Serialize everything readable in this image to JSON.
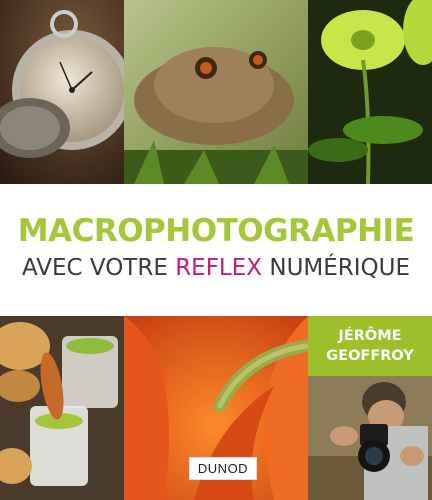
{
  "cover": {
    "title_line1": "MACROPHOTOGRAPHIE",
    "title_line2_pre": "AVEC VOTRE ",
    "title_line2_accent": "REFLEX",
    "title_line2_post": " NUMÉRIQUE",
    "author_first": "JÉRÔME",
    "author_last": "GEOFFROY",
    "publisher": "DUNOD"
  },
  "colors": {
    "title_green": "#a4c639",
    "accent_magenta": "#c4197d",
    "author_box_green": "#9cbf2a"
  },
  "photos": [
    {
      "name": "pocket-watch-photo"
    },
    {
      "name": "toad-photo"
    },
    {
      "name": "green-flower-photo"
    },
    {
      "name": "verrines-food-photo"
    },
    {
      "name": "orange-petal-caterpillar-photo"
    },
    {
      "name": "photographer-photo"
    }
  ]
}
